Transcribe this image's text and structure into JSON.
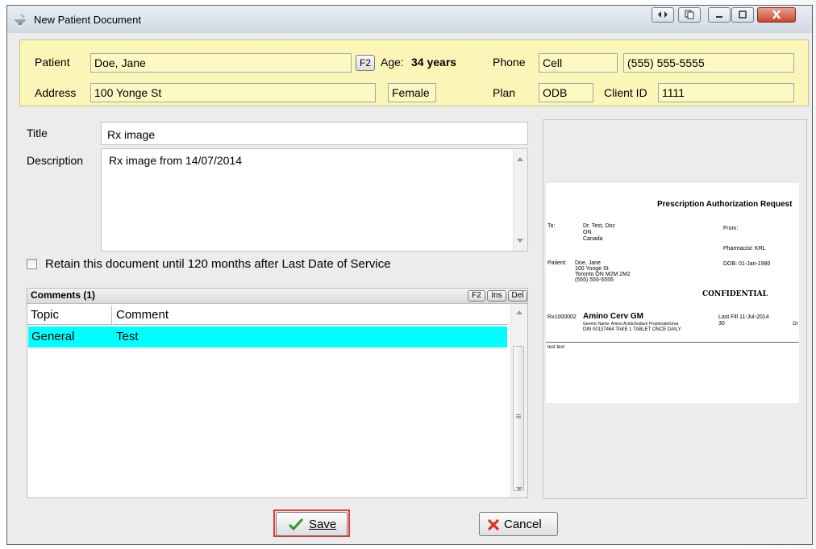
{
  "window": {
    "title": "New Patient Document"
  },
  "patient": {
    "patient_label": "Patient",
    "patient_value": "Doe, Jane",
    "f2_label": "F2",
    "age_label": "Age:",
    "age_value": "34 years",
    "phone_label": "Phone",
    "phone_type": "Cell",
    "phone_number": "(555) 555-5555",
    "address_label": "Address",
    "address_value": "100 Yonge St",
    "gender_value": "Female",
    "plan_label": "Plan",
    "plan_value": "ODB",
    "client_id_label": "Client ID",
    "client_id_value": "1111"
  },
  "form": {
    "title_label": "Title",
    "title_value": "Rx image",
    "description_label": "Description",
    "description_value": "Rx image from 14/07/2014",
    "retain_label": "Retain this document until 120 months after Last Date of Service"
  },
  "comments": {
    "header": "Comments (1)",
    "buttons": [
      "F2",
      "Ins",
      "Del"
    ],
    "columns": [
      "Topic",
      "Comment"
    ],
    "rows": [
      {
        "topic": "General",
        "comment": "Test"
      }
    ]
  },
  "preview": {
    "heading": "Prescription Authorization Request",
    "to_label": "To:",
    "to_name": "Dr. Test, Doc",
    "to_prov": "ON",
    "to_country": "Canada",
    "from_label": "From:",
    "pharmacist": "Pharmacist: KRL",
    "patient_label": "Patient:",
    "patient_name": "Doe, Jane",
    "patient_addr1": "100 Yonge St",
    "patient_addr2": "Toronto ON  M2M 2M2",
    "patient_phone": "(555) 555-5555",
    "dob": "DOB: 01-Jan-1980",
    "confidential": "CONFIDENTIAL",
    "rx_number": "Rx1000002",
    "drug_name": "Amino Cerv GM",
    "generic_name": "Generic Name: Amino Acids/Sodium Propionate/Urea",
    "din_line": "DIN 00137464   TAKE 1 TABLET ONCE DAILY",
    "last_fill": "Last Fill 11-Jul-2014",
    "qty": "30",
    "trail": "Or",
    "notes": "test test"
  },
  "buttons": {
    "save": "Save",
    "cancel": "Cancel"
  },
  "colors": {
    "accent_selection": "#00ffff",
    "patient_panel": "#fbf6b8",
    "save_highlight": "#e53935"
  }
}
